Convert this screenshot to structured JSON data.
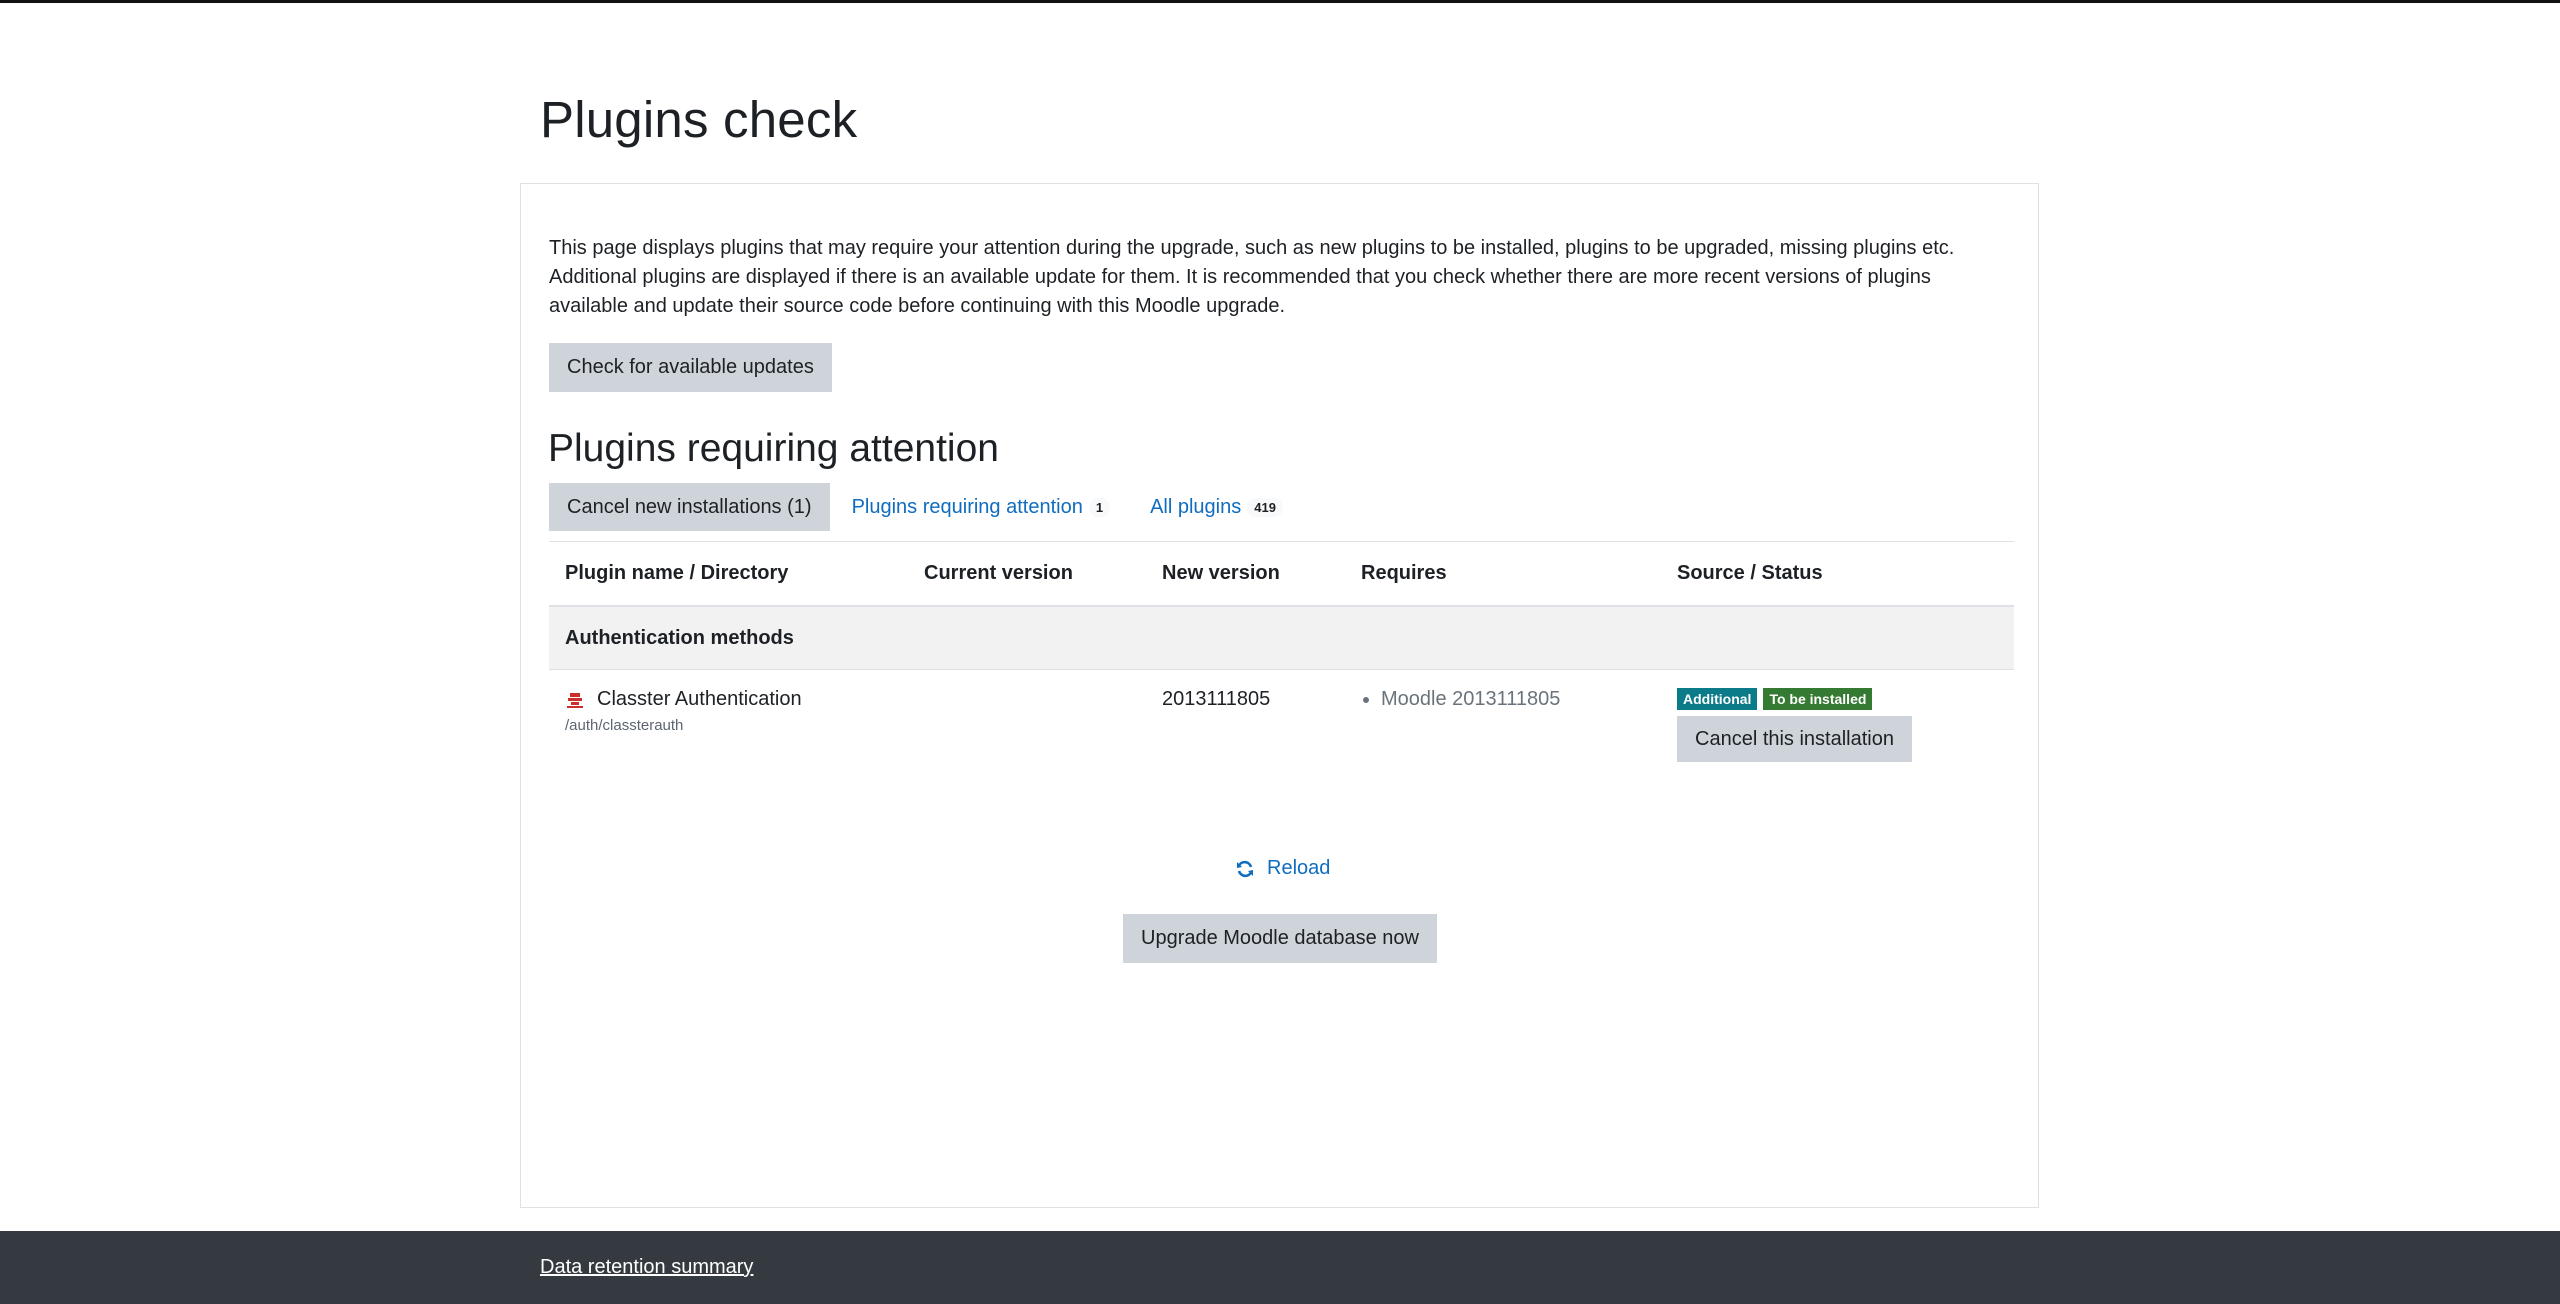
{
  "page": {
    "title": "Plugins check"
  },
  "intro": {
    "text": "This page displays plugins that may require your attention during the upgrade, such as new plugins to be installed, plugins to be upgraded, missing plugins etc. Additional plugins are displayed if there is an available update for them. It is recommended that you check whether there are more recent versions of plugins available and update their source code before continuing with this Moodle upgrade."
  },
  "buttons": {
    "check_updates": "Check for available updates",
    "cancel_new_installations": "Cancel new installations (1)",
    "cancel_this_installation": "Cancel this installation",
    "upgrade": "Upgrade Moodle database now"
  },
  "section": {
    "heading": "Plugins requiring attention"
  },
  "filters": {
    "requiring_attention": {
      "label": "Plugins requiring attention",
      "count": "1"
    },
    "all_plugins": {
      "label": "All plugins",
      "count": "419"
    }
  },
  "table": {
    "headers": [
      "Plugin name / Directory",
      "Current version",
      "New version",
      "Requires",
      "Source / Status"
    ],
    "group": "Authentication methods",
    "rows": [
      {
        "name": "Classter Authentication",
        "directory": "/auth/classterauth",
        "current_version": "",
        "new_version": "2013111805",
        "requires": [
          "Moodle 2013111805"
        ],
        "badges": {
          "source": "Additional",
          "status": "To be installed"
        }
      }
    ]
  },
  "reload": {
    "label": "Reload"
  },
  "footer": {
    "link": "Data retention summary"
  },
  "colors": {
    "link": "#0f6cbf",
    "button_bg": "#ced4da",
    "badge_additional": "#0b7b8a",
    "badge_to_be_installed": "#357a32",
    "footer_bg": "#343a40"
  },
  "icons": {
    "plugin": "plugin-icon",
    "reload": "refresh-icon"
  }
}
